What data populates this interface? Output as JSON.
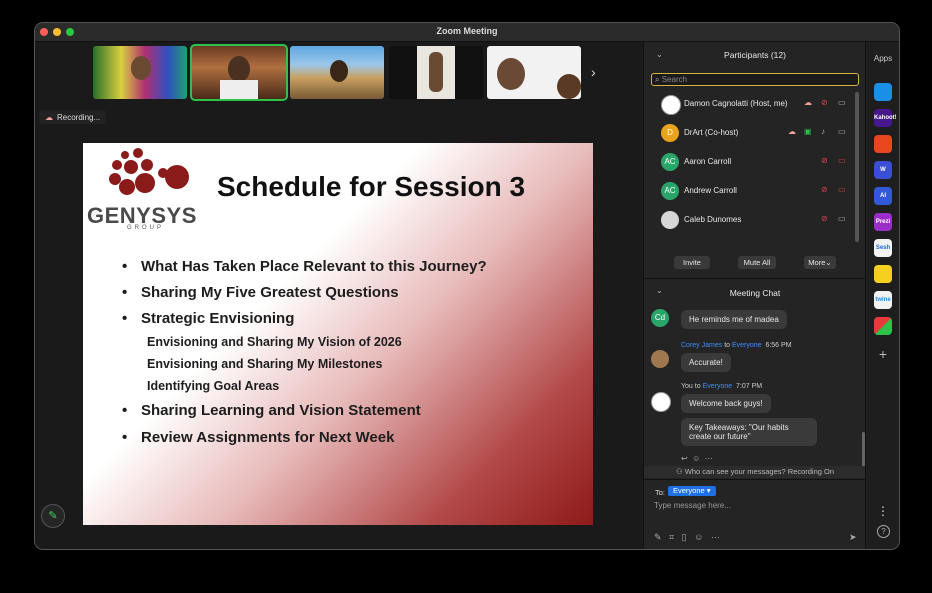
{
  "window": {
    "title": "Zoom Meeting"
  },
  "recording": {
    "label": "Recording..."
  },
  "slide": {
    "title": "Schedule for Session 3",
    "logo": "GENYSYS",
    "logo_sub": "GROUP",
    "bullets": [
      "What Has Taken Place Relevant to this Journey?",
      "Sharing My Five Greatest Questions",
      "Strategic Envisioning"
    ],
    "sub_bullets": [
      "Envisioning and Sharing My Vision of 2026",
      "Envisioning and Sharing My Milestones",
      "Identifying Goal Areas"
    ],
    "bullets_after": [
      "Sharing Learning and Vision Statement",
      "Review Assignments for Next Week"
    ]
  },
  "participants": {
    "header": "Participants (12)",
    "search_placeholder": "Search",
    "list": [
      {
        "initials": "",
        "name": "Damon Cagnolatti (Host, me)",
        "avatar_color": "#ffffff"
      },
      {
        "initials": "D",
        "name": "DrArt (Co-host)",
        "avatar_color": "#e8a21c"
      },
      {
        "initials": "AC",
        "name": "Aaron Carroll",
        "avatar_color": "#2aa56a"
      },
      {
        "initials": "AC",
        "name": "Andrew Carroll",
        "avatar_color": "#2aa56a"
      },
      {
        "initials": "",
        "name": "Caleb Dunomes",
        "avatar_color": "#d6d6d6"
      }
    ],
    "invite_label": "Invite",
    "mute_all_label": "Mute All",
    "more_label": "More"
  },
  "chat": {
    "header": "Meeting Chat",
    "messages": [
      {
        "initials": "Cd",
        "text": "He reminds me of madea"
      },
      {
        "sender": "Corey James",
        "to_word": "to",
        "to": "Everyone",
        "time": "6:56 PM",
        "text": "Accurate!"
      },
      {
        "sender": "You",
        "to_word": "to",
        "to": "Everyone",
        "time": "7:07 PM",
        "text": "Welcome back guys!"
      },
      {
        "text": "Key Takeaways: \"Our habits create our future\""
      }
    ],
    "privacy_note": "Who can see your messages? Recording On",
    "to_label": "To:",
    "to_value": "Everyone",
    "input_placeholder": "Type message here..."
  },
  "apps": {
    "header": "Apps",
    "items": [
      "",
      "Kahoot!",
      "",
      "W",
      "AI",
      "Prezi",
      "Sesh",
      "",
      "twine",
      ""
    ]
  }
}
